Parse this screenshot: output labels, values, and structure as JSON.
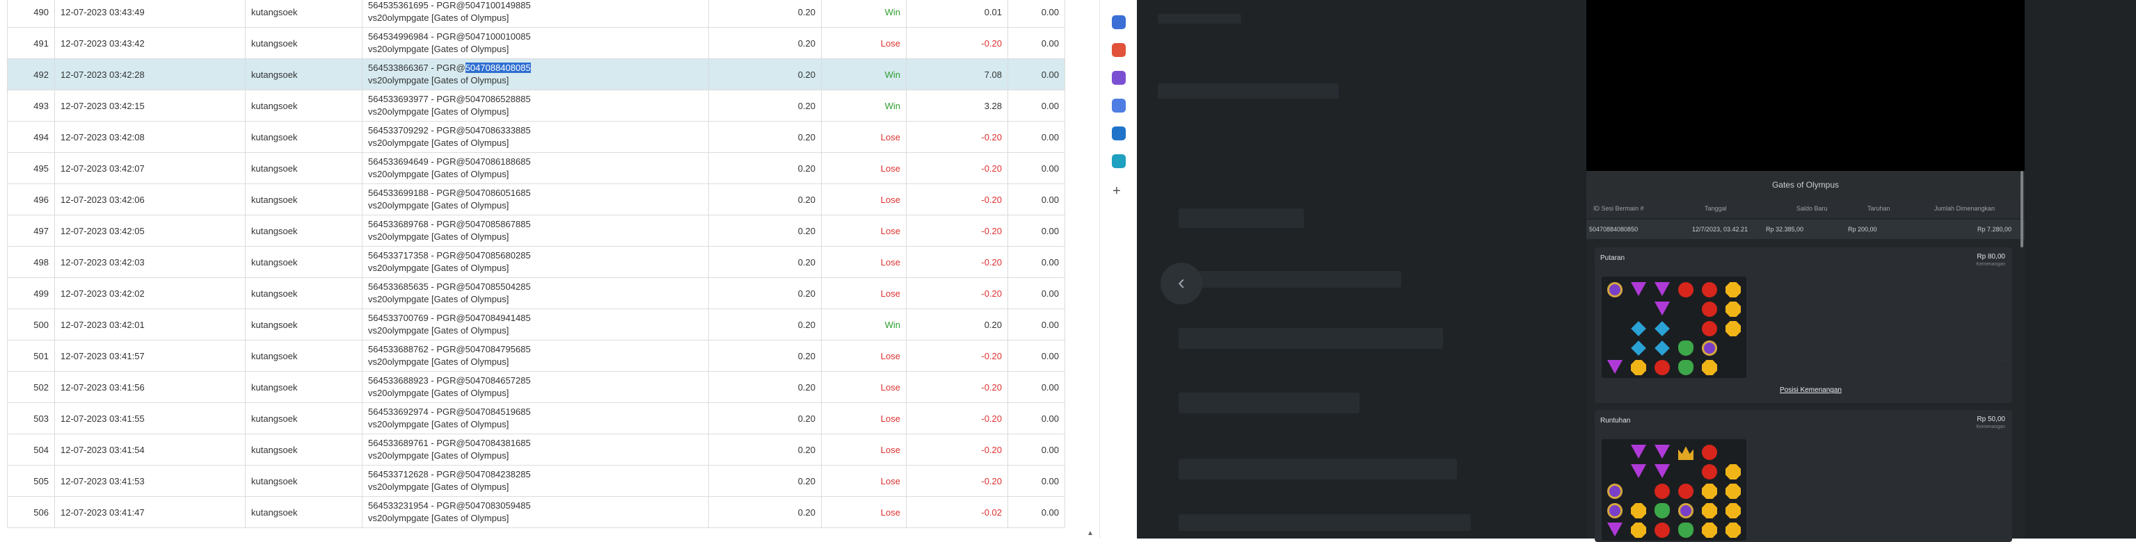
{
  "table": {
    "rows": [
      {
        "no": "490",
        "date": "12-07-2023 03:43:49",
        "user": "kutangsoek",
        "tx_id": "564535361695 - PGR@5047100149885",
        "game": "vs20olympgate [Gates of Olympus]",
        "bet": "0.20",
        "result": "Win",
        "win": "0.01",
        "extra": "0.00"
      },
      {
        "no": "491",
        "date": "12-07-2023 03:43:42",
        "user": "kutangsoek",
        "tx_id": "564534996984 - PGR@5047100010085",
        "game": "vs20olympgate [Gates of Olympus]",
        "bet": "0.20",
        "result": "Lose",
        "win": "-0.20",
        "extra": "0.00"
      },
      {
        "no": "492",
        "date": "12-07-2023 03:42:28",
        "user": "kutangsoek",
        "tx_prefix": "564533866367 - PGR@",
        "tx_highlight": "5047088408085",
        "game": "vs20olympgate [Gates of Olympus]",
        "bet": "0.20",
        "result": "Win",
        "win": "7.08",
        "extra": "0.00"
      },
      {
        "no": "493",
        "date": "12-07-2023 03:42:15",
        "user": "kutangsoek",
        "tx_id": "564533693977 - PGR@5047086528885",
        "game": "vs20olympgate [Gates of Olympus]",
        "bet": "0.20",
        "result": "Win",
        "win": "3.28",
        "extra": "0.00"
      },
      {
        "no": "494",
        "date": "12-07-2023 03:42:08",
        "user": "kutangsoek",
        "tx_id": "564533709292 - PGR@5047086333885",
        "game": "vs20olympgate [Gates of Olympus]",
        "bet": "0.20",
        "result": "Lose",
        "win": "-0.20",
        "extra": "0.00"
      },
      {
        "no": "495",
        "date": "12-07-2023 03:42:07",
        "user": "kutangsoek",
        "tx_id": "564533694649 - PGR@5047086188685",
        "game": "vs20olympgate [Gates of Olympus]",
        "bet": "0.20",
        "result": "Lose",
        "win": "-0.20",
        "extra": "0.00"
      },
      {
        "no": "496",
        "date": "12-07-2023 03:42:06",
        "user": "kutangsoek",
        "tx_id": "564533699188 - PGR@5047086051685",
        "game": "vs20olympgate [Gates of Olympus]",
        "bet": "0.20",
        "result": "Lose",
        "win": "-0.20",
        "extra": "0.00"
      },
      {
        "no": "497",
        "date": "12-07-2023 03:42:05",
        "user": "kutangsoek",
        "tx_id": "564533689768 - PGR@5047085867885",
        "game": "vs20olympgate [Gates of Olympus]",
        "bet": "0.20",
        "result": "Lose",
        "win": "-0.20",
        "extra": "0.00"
      },
      {
        "no": "498",
        "date": "12-07-2023 03:42:03",
        "user": "kutangsoek",
        "tx_id": "564533717358 - PGR@5047085680285",
        "game": "vs20olympgate [Gates of Olympus]",
        "bet": "0.20",
        "result": "Lose",
        "win": "-0.20",
        "extra": "0.00"
      },
      {
        "no": "499",
        "date": "12-07-2023 03:42:02",
        "user": "kutangsoek",
        "tx_id": "564533685635 - PGR@5047085504285",
        "game": "vs20olympgate [Gates of Olympus]",
        "bet": "0.20",
        "result": "Lose",
        "win": "-0.20",
        "extra": "0.00"
      },
      {
        "no": "500",
        "date": "12-07-2023 03:42:01",
        "user": "kutangsoek",
        "tx_id": "564533700769 - PGR@5047084941485",
        "game": "vs20olympgate [Gates of Olympus]",
        "bet": "0.20",
        "result": "Win",
        "win": "0.20",
        "extra": "0.00"
      },
      {
        "no": "501",
        "date": "12-07-2023 03:41:57",
        "user": "kutangsoek",
        "tx_id": "564533688762 - PGR@5047084795685",
        "game": "vs20olympgate [Gates of Olympus]",
        "bet": "0.20",
        "result": "Lose",
        "win": "-0.20",
        "extra": "0.00"
      },
      {
        "no": "502",
        "date": "12-07-2023 03:41:56",
        "user": "kutangsoek",
        "tx_id": "564533688923 - PGR@5047084657285",
        "game": "vs20olympgate [Gates of Olympus]",
        "bet": "0.20",
        "result": "Lose",
        "win": "-0.20",
        "extra": "0.00"
      },
      {
        "no": "503",
        "date": "12-07-2023 03:41:55",
        "user": "kutangsoek",
        "tx_id": "564533692974 - PGR@5047084519685",
        "game": "vs20olympgate [Gates of Olympus]",
        "bet": "0.20",
        "result": "Lose",
        "win": "-0.20",
        "extra": "0.00"
      },
      {
        "no": "504",
        "date": "12-07-2023 03:41:54",
        "user": "kutangsoek",
        "tx_id": "564533689761 - PGR@5047084381685",
        "game": "vs20olympgate [Gates of Olympus]",
        "bet": "0.20",
        "result": "Lose",
        "win": "-0.20",
        "extra": "0.00"
      },
      {
        "no": "505",
        "date": "12-07-2023 03:41:53",
        "user": "kutangsoek",
        "tx_id": "564533712628 - PGR@5047084238285",
        "game": "vs20olympgate [Gates of Olympus]",
        "bet": "0.20",
        "result": "Lose",
        "win": "-0.20",
        "extra": "0.00"
      },
      {
        "no": "506",
        "date": "12-07-2023 03:41:47",
        "user": "kutangsoek",
        "tx_id": "564533231954 - PGR@5047083059485",
        "game": "vs20olympgate [Gates of Olympus]",
        "bet": "0.20",
        "result": "Lose",
        "win": "-0.02",
        "extra": "0.00"
      }
    ]
  },
  "sidebar": {
    "icons": [
      {
        "name": "tag-icon",
        "color": "#3b6fd6"
      },
      {
        "name": "toolbox-icon",
        "color": "#e0523a"
      },
      {
        "name": "people-icon",
        "color": "#7b4fd2"
      },
      {
        "name": "copilot-icon",
        "color": "#4f7de3"
      },
      {
        "name": "outlook-icon",
        "color": "#1f73c9"
      },
      {
        "name": "shopping-icon",
        "color": "#1ea0c0"
      }
    ],
    "add_label": "+"
  },
  "history": {
    "title": "Gates of Olympus",
    "headers": {
      "round_id": "ID Sesi Bermain #",
      "date": "Tanggal",
      "balance": "Saldo Baru",
      "bet": "Taruhan",
      "win": "Jumlah Dimenangkan"
    },
    "row": {
      "round_id": "50470884080850",
      "date": "12/7/2023, 03.42.21",
      "balance": "Rp 32.385,00",
      "bet": "Rp 200,00",
      "win": "Rp 7.280,00"
    },
    "sections": [
      {
        "title": "Putaran",
        "amount": "Rp 80,00",
        "note": "Kemenangan",
        "link": "Posisi Kemenangan"
      },
      {
        "title": "Runtuhan",
        "amount": "Rp 50,00",
        "note": "Kemenangan"
      }
    ]
  },
  "back_arrow": "‹"
}
